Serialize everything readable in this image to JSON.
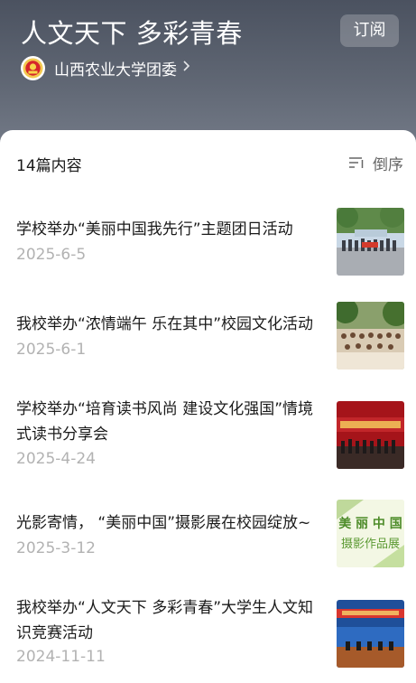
{
  "header": {
    "title": "人文天下 多彩青春",
    "subscribe_label": "订阅",
    "account_name": "山西农业大学团委"
  },
  "list_header": {
    "count_label": "14篇内容",
    "sort_label": "倒序"
  },
  "articles": [
    {
      "title": "学校举办“美丽中国我先行”主题团日活动",
      "date": "2025-6-5"
    },
    {
      "title": "我校举办“浓情端午 乐在其中”校园文化活动",
      "date": "2025-6-1"
    },
    {
      "title": "学校举办“培育读书风尚 建设文化强国”情境式读书分享会",
      "date": "2025-4-24"
    },
    {
      "title": "光影寄情， “美丽中国”摄影展在校园绽放~",
      "date": "2025-3-12",
      "thumb_text_line1": "美 丽 中 国",
      "thumb_text_line2": "摄影作品展"
    },
    {
      "title": "我校举办“人文天下 多彩青春”大学生人文知识竞赛活动",
      "date": "2024-11-11"
    }
  ],
  "icons": {
    "logo": "youth-league-emblem-icon",
    "chevron": "chevron-right-icon",
    "sort": "sort-lines-icon"
  }
}
